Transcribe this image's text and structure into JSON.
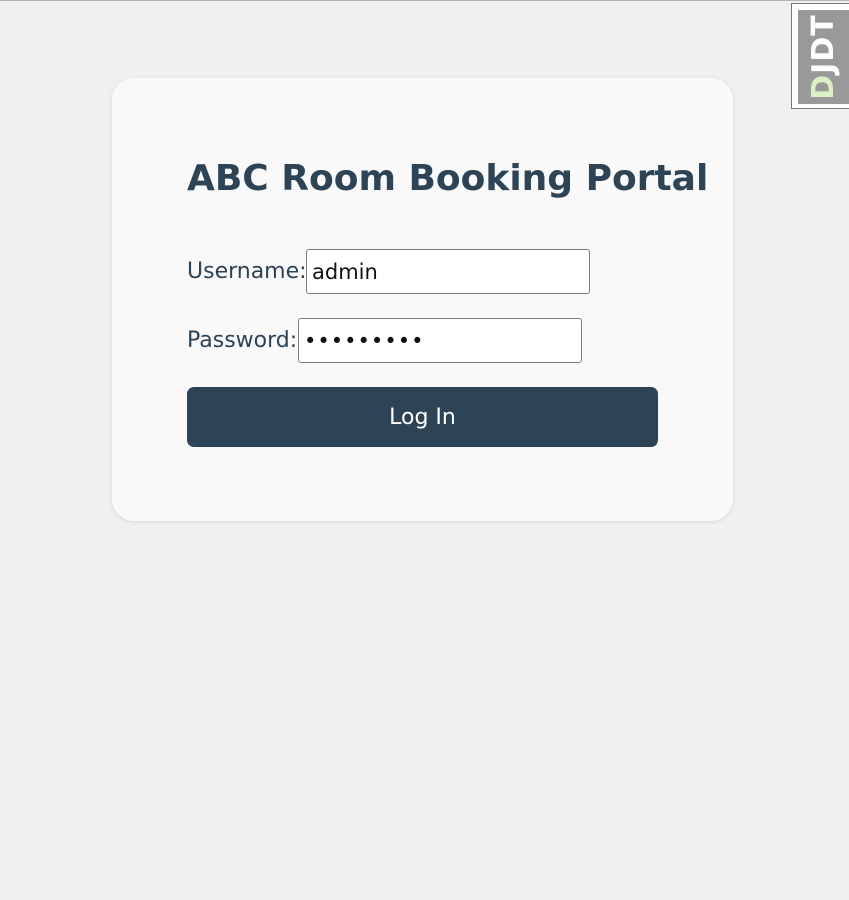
{
  "page": {
    "title": "ABC Room Booking Portal"
  },
  "form": {
    "username_label": "Username:",
    "username_value": "admin",
    "password_label": "Password:",
    "password_value": "•••••••••",
    "submit_label": "Log In"
  },
  "debug_toolbar": {
    "accent_letter": "D",
    "rest_letters": "JDT"
  },
  "colors": {
    "background": "#f0f0f0",
    "card": "#f9f9f9",
    "primary": "#2d4356",
    "button_text": "#ffffff",
    "toolbar_handle": "#999999",
    "toolbar_accent": "#dbf0c4"
  }
}
